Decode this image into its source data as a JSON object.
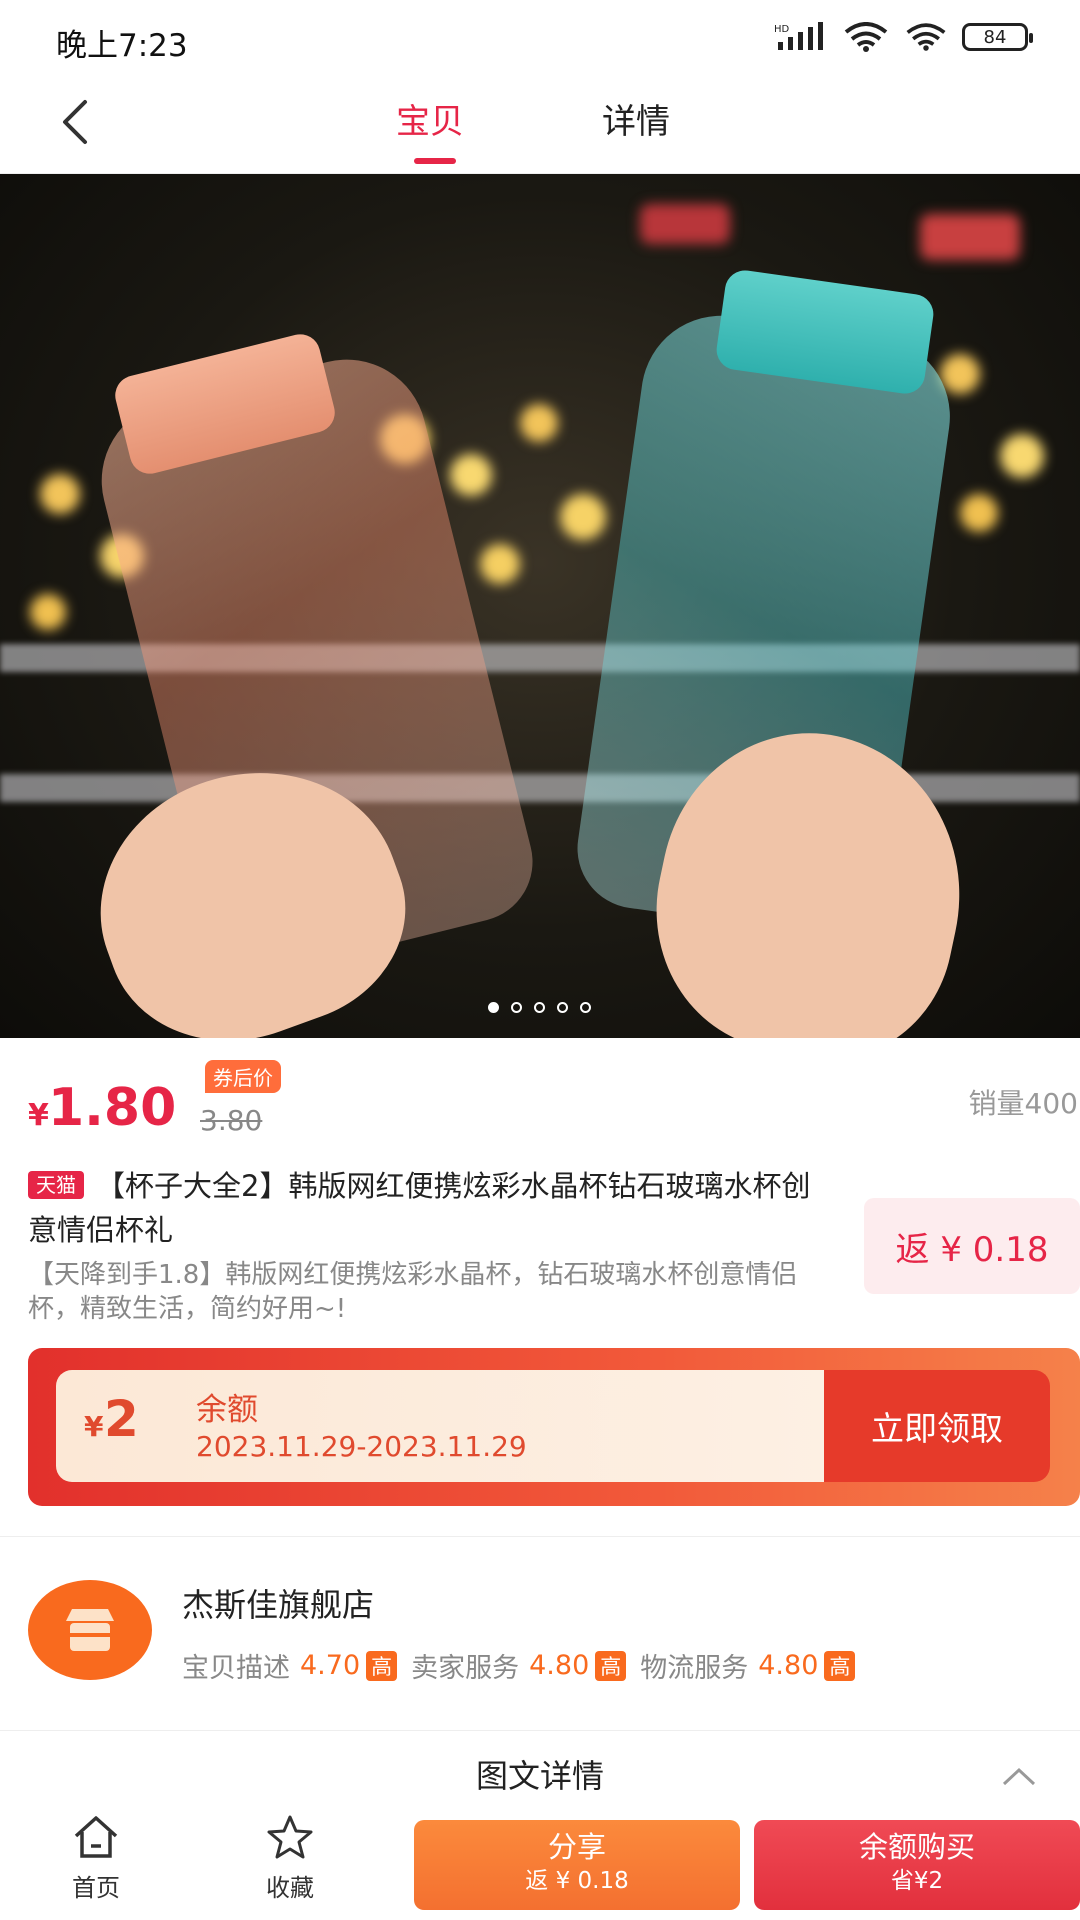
{
  "status_bar": {
    "time": "晚上7:23",
    "battery": "84",
    "hd_label": "HD"
  },
  "nav": {
    "tabs": [
      {
        "label": "宝贝",
        "active": true
      },
      {
        "label": "详情",
        "active": false
      }
    ]
  },
  "gallery": {
    "image_description": "product photo",
    "page_count": 5,
    "current_page": 1
  },
  "product": {
    "currency": "¥",
    "price": "1.80",
    "original_price": "3.80",
    "price_tag": "券后价",
    "sales": "销量400",
    "platform_badge": "天猫",
    "title": "【杯子大全2】韩版网红便携炫彩水晶杯钻石玻璃水杯创意情侣杯礼",
    "description": "【天降到手1.8】韩版网红便携炫彩水晶杯，钻石玻璃水杯创意情侣杯，精致生活，简约好用~!",
    "rebate": "返 ¥ 0.18"
  },
  "coupon": {
    "currency": "¥",
    "amount": "2",
    "label": "余额",
    "dates": "2023.11.29-2023.11.29",
    "cta": "立即领取"
  },
  "shop": {
    "name": "杰斯佳旗舰店",
    "ratings": [
      {
        "label": "宝贝描述",
        "value": "4.70",
        "level": "高"
      },
      {
        "label": "卖家服务",
        "value": "4.80",
        "level": "高"
      },
      {
        "label": "物流服务",
        "value": "4.80",
        "level": "高"
      }
    ]
  },
  "detail_section": {
    "title": "图文详情"
  },
  "bottom_bar": {
    "home": "首页",
    "favorite": "收藏",
    "share": {
      "label": "分享",
      "sub": "返 ¥ 0.18"
    },
    "buy": {
      "label": "余额购买",
      "sub": "省¥2"
    }
  },
  "colors": {
    "accent": "#e62547",
    "orange": "#f96a1e",
    "coupon_red": "#e2302c"
  }
}
